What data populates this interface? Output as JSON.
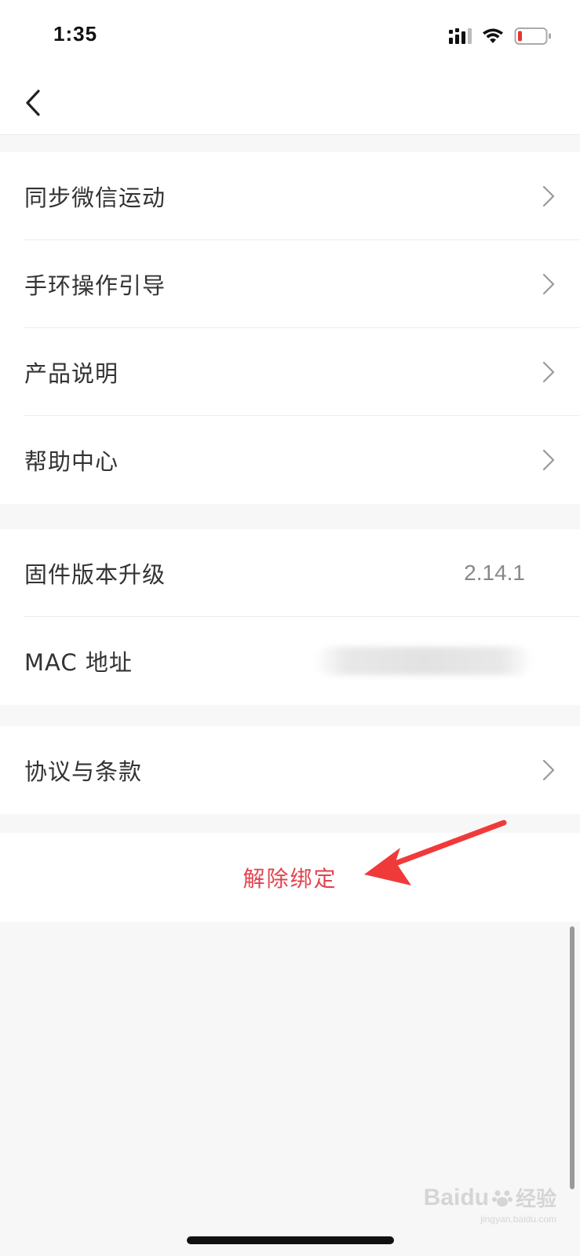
{
  "status_bar": {
    "time": "1:35"
  },
  "nav": {
    "back_icon": "chevron-left-icon"
  },
  "groups": {
    "group1": [
      {
        "label": "同步微信运动"
      },
      {
        "label": "手环操作引导"
      },
      {
        "label": "产品说明"
      },
      {
        "label": "帮助中心"
      }
    ],
    "group2": [
      {
        "label": "固件版本升级",
        "value": "2.14.1"
      },
      {
        "label": "MAC 地址"
      }
    ],
    "group3": [
      {
        "label": "协议与条款"
      }
    ]
  },
  "unbind": {
    "label": "解除绑定",
    "color": "#e2434f"
  },
  "watermark": {
    "logo_text": "Baidu",
    "logo_suffix": "经验",
    "sub": "jingyan.baidu.com"
  },
  "colors": {
    "accent_red": "#e2434f",
    "annotation_arrow": "#f03a3a",
    "background": "#f7f7f7"
  }
}
